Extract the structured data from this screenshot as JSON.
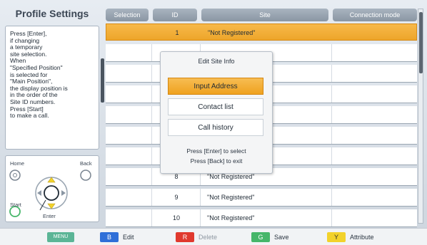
{
  "page": {
    "title": "Profile Settings"
  },
  "help": {
    "text": "Press [Enter],\nif changing\na temporary\nsite selection.\nWhen\n\"Specified Position\"\nis selected for\n\"Main Position\",\nthe display position is\nin the order of the\nSite ID numbers.\nPress [Start]\nto make a call."
  },
  "remote": {
    "home": "Home",
    "back": "Back",
    "start": "Start",
    "enter": "Enter"
  },
  "table": {
    "headers": {
      "selection": "Selection",
      "id": "ID",
      "site": "Site",
      "mode": "Connection mode"
    },
    "rows": [
      {
        "id": "1",
        "site": "\"Not Registered\""
      },
      {
        "id": "",
        "site": ""
      },
      {
        "id": "",
        "site": ""
      },
      {
        "id": "",
        "site": ""
      },
      {
        "id": "",
        "site": ""
      },
      {
        "id": "",
        "site": ""
      },
      {
        "id": "",
        "site": ""
      },
      {
        "id": "8",
        "site": "\"Not Registered\""
      },
      {
        "id": "9",
        "site": "\"Not Registered\""
      },
      {
        "id": "10",
        "site": "\"Not Registered\""
      }
    ]
  },
  "popup": {
    "title": "Edit Site Info",
    "btn_input": "Input Address",
    "btn_contact": "Contact list",
    "btn_history": "Call history",
    "hint1": "Press [Enter] to select",
    "hint2": "Press [Back] to exit"
  },
  "bottom": {
    "menu": "MENU",
    "b_key": "B",
    "b_label": "Edit",
    "r_key": "R",
    "r_label": "Delete",
    "g_key": "G",
    "g_label": "Save",
    "y_key": "Y",
    "y_label": "Attribute"
  },
  "colors": {
    "accent": "#f0a82c",
    "blue": "#2f6fd8",
    "red": "#e0392e",
    "green": "#46b66a",
    "yellow": "#f2d22b"
  }
}
